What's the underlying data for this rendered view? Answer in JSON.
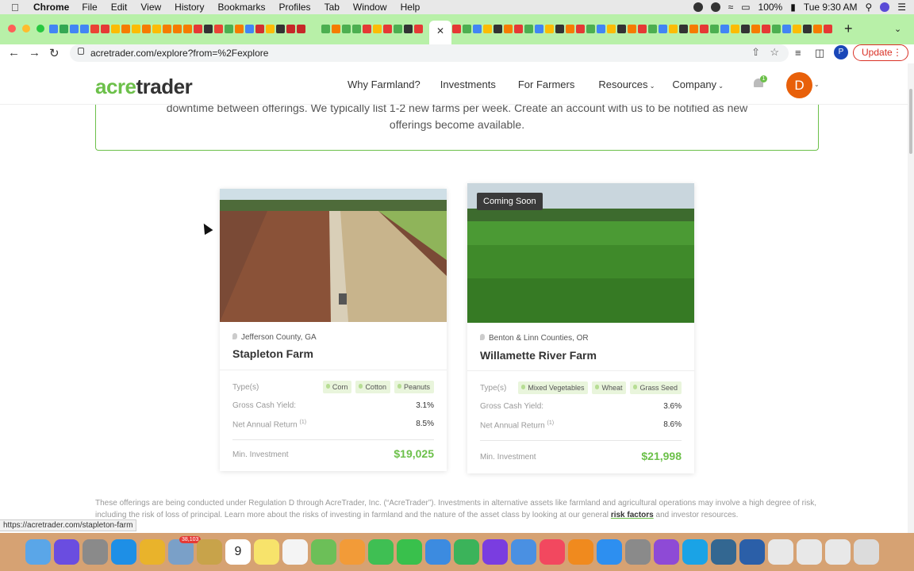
{
  "menubar": {
    "app": "Chrome",
    "items": [
      "File",
      "Edit",
      "View",
      "History",
      "Bookmarks",
      "Profiles",
      "Tab",
      "Window",
      "Help"
    ],
    "battery": "100%",
    "clock": "Tue 9:30 AM"
  },
  "browser": {
    "url": "acretrader.com/explore?from=%2Fexplore",
    "profile_initial": "P",
    "update_label": "Update",
    "status_url": "https://acretrader.com/stapleton-farm"
  },
  "site": {
    "logo_part1": "acre",
    "logo_part2": "trader",
    "nav": [
      "Why Farmland?",
      "Investments",
      "For Farmers",
      "Resources",
      "Company"
    ],
    "bell_badge": "1",
    "avatar_initial": "D",
    "notice_line1": "downtime between offerings. We typically list 1-2 new farms per week. Create an account with us to be notified as new",
    "notice_line2": "offerings become available."
  },
  "cards": [
    {
      "location": "Jefferson County, GA",
      "name": "Stapleton Farm",
      "badge": "",
      "types_label": "Type(s)",
      "tags": [
        "Corn",
        "Cotton",
        "Peanuts"
      ],
      "yield_label": "Gross Cash Yield:",
      "yield_value": "3.1%",
      "return_label": "Net Annual Return",
      "return_sup": "(1)",
      "return_value": "8.5%",
      "min_label": "Min. Investment",
      "min_value": "$19,025"
    },
    {
      "location": "Benton & Linn Counties, OR",
      "name": "Willamette River Farm",
      "badge": "Coming Soon",
      "types_label": "Type(s)",
      "tags": [
        "Mixed Vegetables",
        "Wheat",
        "Grass Seed"
      ],
      "yield_label": "Gross Cash Yield:",
      "yield_value": "3.6%",
      "return_label": "Net Annual Return",
      "return_sup": "(1)",
      "return_value": "8.6%",
      "min_label": "Min. Investment",
      "min_value": "$21,998"
    }
  ],
  "disclaimer": {
    "text1": "These offerings are being conducted under Regulation D through AcreTrader, Inc. (“AcreTrader”). Investments in alternative assets like farmland and agricultural operations may involve a high degree of risk, including the risk of loss of principal. Learn more about the risks of investing in farmland and the nature of the asset class by looking at our general ",
    "link": "risk factors",
    "text2": " and investor resources."
  },
  "dock": {
    "calendar_day": "9",
    "mail_badge": "38,103"
  }
}
